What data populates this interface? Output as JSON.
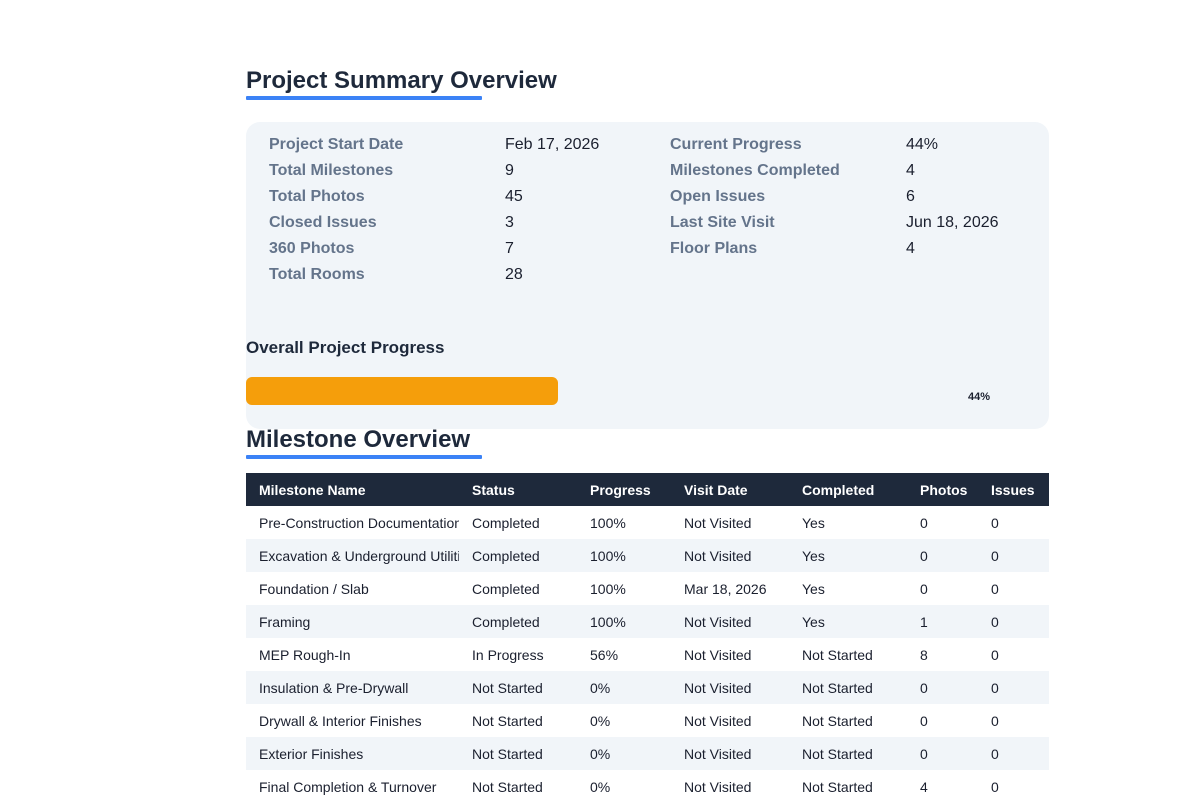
{
  "summary": {
    "title": "Project Summary Overview",
    "left": [
      {
        "label": "Project Start Date",
        "value": "Feb 17, 2026"
      },
      {
        "label": "Total Milestones",
        "value": "9"
      },
      {
        "label": "Total Photos",
        "value": "45"
      },
      {
        "label": "Closed Issues",
        "value": "3"
      },
      {
        "label": "360 Photos",
        "value": "7"
      },
      {
        "label": "Total Rooms",
        "value": "28"
      }
    ],
    "right": [
      {
        "label": "Current Progress",
        "value": "44%"
      },
      {
        "label": "Milestones Completed",
        "value": "4"
      },
      {
        "label": "Open Issues",
        "value": "6"
      },
      {
        "label": "Last Site Visit",
        "value": "Jun 18, 2026"
      },
      {
        "label": "Floor Plans",
        "value": "4"
      }
    ],
    "progress": {
      "heading": "Overall Project Progress",
      "percent_label": "44%",
      "fraction": 0.44,
      "color": "#f59e0b"
    }
  },
  "milestones": {
    "title": "Milestone Overview",
    "columns": [
      "Milestone Name",
      "Status",
      "Progress",
      "Visit Date",
      "Completed",
      "Photos",
      "Issues"
    ],
    "rows": [
      [
        "Pre-Construction Documentation",
        "Completed",
        "100%",
        "Not Visited",
        "Yes",
        "0",
        "0"
      ],
      [
        "Excavation & Underground Utilities",
        "Completed",
        "100%",
        "Not Visited",
        "Yes",
        "0",
        "0"
      ],
      [
        "Foundation / Slab",
        "Completed",
        "100%",
        "Mar 18, 2026",
        "Yes",
        "0",
        "0"
      ],
      [
        "Framing",
        "Completed",
        "100%",
        "Not Visited",
        "Yes",
        "1",
        "0"
      ],
      [
        "MEP Rough-In",
        "In Progress",
        "56%",
        "Not Visited",
        "Not Started",
        "8",
        "0"
      ],
      [
        "Insulation & Pre-Drywall",
        "Not Started",
        "0%",
        "Not Visited",
        "Not Started",
        "0",
        "0"
      ],
      [
        "Drywall & Interior Finishes",
        "Not Started",
        "0%",
        "Not Visited",
        "Not Started",
        "0",
        "0"
      ],
      [
        "Exterior Finishes",
        "Not Started",
        "0%",
        "Not Visited",
        "Not Started",
        "0",
        "0"
      ],
      [
        "Final Completion & Turnover",
        "Not Started",
        "0%",
        "Not Visited",
        "Not Started",
        "4",
        "0"
      ]
    ]
  },
  "colors": {
    "accent": "#3b82f6",
    "header_bg": "#1e293b",
    "card_bg": "#f1f5f9",
    "progress": "#f59e0b"
  }
}
